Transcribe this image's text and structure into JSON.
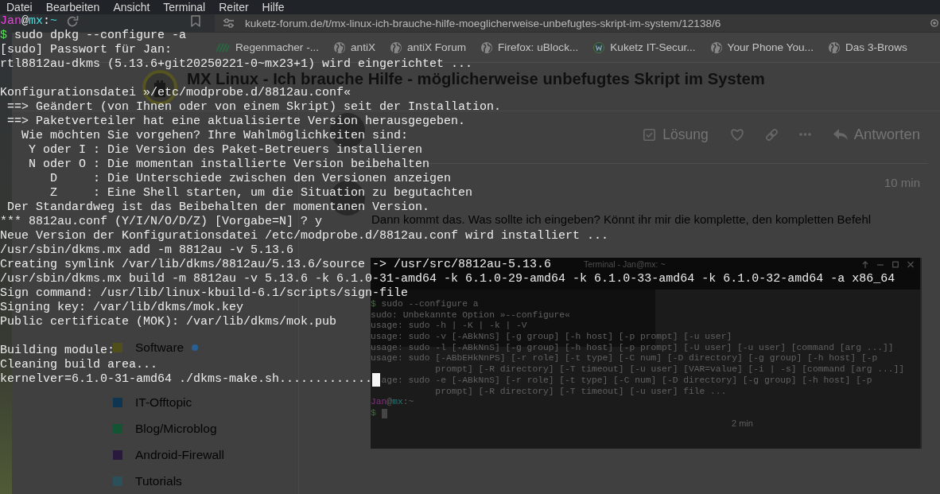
{
  "terminal": {
    "menu": [
      "Datei",
      "Bearbeiten",
      "Ansicht",
      "Terminal",
      "Reiter",
      "Hilfe"
    ],
    "lines": [
      {
        "kind": "prompt",
        "user": "Jan",
        "at": "@",
        "host": "mx",
        "sep": ":",
        "path": "~"
      },
      {
        "kind": "command",
        "sign": "$",
        "text": "sudo dpkg --configure -a"
      },
      {
        "kind": "output",
        "text": "[sudo] Passwort für Jan:"
      },
      {
        "kind": "output",
        "text": "rtl8812au-dkms (5.13.6+git20250221-0~mx23+1) wird eingerichtet ..."
      },
      {
        "kind": "blank"
      },
      {
        "kind": "output",
        "text": "Konfigurationsdatei »/etc/modprobe.d/8812au.conf«"
      },
      {
        "kind": "output",
        "text": " ==> Geändert (von Ihnen oder von einem Skript) seit der Installation."
      },
      {
        "kind": "output",
        "text": " ==> Paketverteiler hat eine aktualisierte Version herausgegeben."
      },
      {
        "kind": "output",
        "text": "   Wie möchten Sie vorgehen? Ihre Wahlmöglichkeiten sind:"
      },
      {
        "kind": "output",
        "text": "    Y oder I : Die Version des Paket-Betreuers installieren"
      },
      {
        "kind": "output",
        "text": "    N oder O : Die momentan installierte Version beibehalten"
      },
      {
        "kind": "output",
        "text": "       D     : Die Unterschiede zwischen den Versionen anzeigen"
      },
      {
        "kind": "output",
        "text": "       Z     : Eine Shell starten, um die Situation zu begutachten"
      },
      {
        "kind": "output",
        "text": " Der Standardweg ist das Beibehalten der momentanen Version."
      },
      {
        "kind": "output",
        "text": "*** 8812au.conf (Y/I/N/O/D/Z) [Vorgabe=N] ? y"
      },
      {
        "kind": "output",
        "text": "Neue Version der Konfigurationsdatei /etc/modprobe.d/8812au.conf wird installiert ..."
      },
      {
        "kind": "output",
        "text": "/usr/sbin/dkms.mx add -m 8812au -v 5.13.6"
      },
      {
        "kind": "output",
        "text": "Creating symlink /var/lib/dkms/8812au/5.13.6/source -> /usr/src/8812au-5.13.6"
      },
      {
        "kind": "output",
        "text": "/usr/sbin/dkms.mx build -m 8812au -v 5.13.6 -k 6.1.0-31-amd64 -k 6.1.0-29-amd64 -k 6.1.0-33-amd64 -k 6.1.0-32-amd64 -a x86_64"
      },
      {
        "kind": "output",
        "text": "Sign command: /usr/lib/linux-kbuild-6.1/scripts/sign-file"
      },
      {
        "kind": "output",
        "text": "Signing key: /var/lib/dkms/mok.key"
      },
      {
        "kind": "output",
        "text": "Public certificate (MOK): /var/lib/dkms/mok.pub"
      },
      {
        "kind": "blank"
      },
      {
        "kind": "output",
        "text": "Building module:"
      },
      {
        "kind": "output",
        "text": "Cleaning build area..."
      },
      {
        "kind": "output",
        "text": "kernelver=6.1.0-31-amd64 ./dkms-make.sh............."
      }
    ]
  },
  "browser": {
    "url": "kuketz-forum.de/t/mx-linux-ich-brauche-hilfe-moeglicherweise-unbefugtes-skript-im-system/12138/6",
    "bookmarks": [
      {
        "label": "Regenmacher -...",
        "kind": "regen"
      },
      {
        "label": "antiX",
        "kind": "globe"
      },
      {
        "label": "antiX Forum",
        "kind": "globe"
      },
      {
        "label": "Firefox: uBlock...",
        "kind": "globe"
      },
      {
        "label": "Kuketz IT-Secur...",
        "kind": "kuketz"
      },
      {
        "label": "Your Phone You...",
        "kind": "globe"
      },
      {
        "label": "Das 3-Brows",
        "kind": "globe"
      }
    ]
  },
  "forum_header": {
    "title": "MX Linux - Ich brauche Hilfe - möglicherweise unbefugtes Skript im System"
  },
  "sidebar": {
    "categories": [
      {
        "label": "Software",
        "color": "#56531c",
        "unread": true
      },
      {
        "label": "IT-Offtopic",
        "color": "#0f3a55",
        "unread": false
      },
      {
        "label": "Blog/Microblog",
        "color": "#155a37",
        "unread": false
      },
      {
        "label": "Android-Firewall",
        "color": "#2d1b43",
        "unread": false
      },
      {
        "label": "Tutorials",
        "color": "#2f5660",
        "unread": false
      }
    ]
  },
  "post_actions": [
    {
      "kind": "solution",
      "label": "Lösung"
    },
    {
      "kind": "like"
    },
    {
      "kind": "link"
    },
    {
      "kind": "more"
    },
    {
      "kind": "reply",
      "label": "Antworten"
    }
  ],
  "post": {
    "time": "10 min",
    "text": "Dann kommt das. Was sollte ich eingeben? Könnt ihr mir die komplette, den kompletten Befehl",
    "screenshot": {
      "title": "Terminal - Jan@mx: ~",
      "lines": [
        {
          "kind": "command",
          "sign": "$",
          "text": "sudo --configure a"
        },
        {
          "kind": "output",
          "text": "sudo: Unbekannte Option »--configure«"
        },
        {
          "kind": "output",
          "text": "usage: sudo -h | -K | -k | -V"
        },
        {
          "kind": "output",
          "text": "usage: sudo -v [-ABkNnS] [-g group] [-h host] [-p prompt] [-u user]"
        },
        {
          "kind": "output",
          "text": "usage: sudo -l [-ABkNnS] [-g group] [-h host] [-p prompt] [-U user] [-u user] [command [arg ...]]"
        },
        {
          "kind": "output",
          "text": "usage: sudo [-ABbEHkNnPS] [-r role] [-t type] [-C num] [-D directory] [-g group] [-h host] [-p"
        },
        {
          "kind": "output",
          "text": "            prompt] [-R directory] [-T timeout] [-u user] [VAR=value] [-i | -s] [command [arg ...]]"
        },
        {
          "kind": "obscured",
          "text": "age: sudo -e [-ABkNnS] [-r role] [-t type] [-C num] [-D directory] [-g group] [-h host] [-p"
        },
        {
          "kind": "output",
          "text": "            prompt] [-R directory] [-T timeout] [-u user] file ..."
        },
        {
          "kind": "prompt",
          "user": "Jan",
          "at": "@",
          "host": "mx",
          "sep": ":",
          "path": "~"
        },
        {
          "kind": "input",
          "sign": "$"
        }
      ],
      "behind_time": "2 min"
    }
  }
}
